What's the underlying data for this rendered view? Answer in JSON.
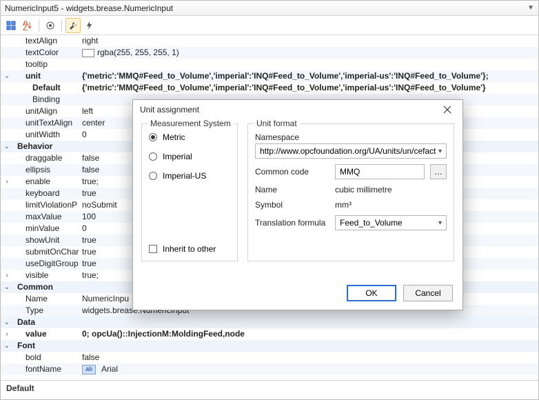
{
  "window": {
    "title": "NumericInput5 - widgets.brease.NumericInput"
  },
  "toolbar": {
    "btn1": "categorized-icon",
    "btn2": "sort-az-icon",
    "btn3": "target-icon",
    "btn4": "wrench-icon",
    "btn5": "bolt-icon"
  },
  "props": {
    "textAlign": {
      "k": "textAlign",
      "v": "right"
    },
    "textColor": {
      "k": "textColor",
      "v": "rgba(255, 255, 255, 1)"
    },
    "tooltip": {
      "k": "tooltip",
      "v": ""
    },
    "unit": {
      "k": "unit",
      "v": "{'metric':'MMQ#Feed_to_Volume','imperial':'INQ#Feed_to_Volume','imperial-us':'INQ#Feed_to_Volume'};"
    },
    "unitDefault": {
      "k": "Default",
      "v": "{'metric':'MMQ#Feed_to_Volume','imperial':'INQ#Feed_to_Volume','imperial-us':'INQ#Feed_to_Volume'}"
    },
    "unitBinding": {
      "k": "Binding",
      "v": ""
    },
    "unitAlign": {
      "k": "unitAlign",
      "v": "left"
    },
    "unitTextAlign": {
      "k": "unitTextAlign",
      "v": "center"
    },
    "unitWidth": {
      "k": "unitWidth",
      "v": "0"
    },
    "behavior": {
      "k": "Behavior"
    },
    "draggable": {
      "k": "draggable",
      "v": "false"
    },
    "ellipsis": {
      "k": "ellipsis",
      "v": "false"
    },
    "enable": {
      "k": "enable",
      "v": "true;"
    },
    "keyboard": {
      "k": "keyboard",
      "v": "true"
    },
    "limitViolationP": {
      "k": "limitViolationP",
      "v": "noSubmit"
    },
    "maxValue": {
      "k": "maxValue",
      "v": "100"
    },
    "minValue": {
      "k": "minValue",
      "v": "0"
    },
    "showUnit": {
      "k": "showUnit",
      "v": "true"
    },
    "submitOnChar": {
      "k": "submitOnChar",
      "v": "true"
    },
    "useDigitGroup": {
      "k": "useDigitGroup",
      "v": "true"
    },
    "visible": {
      "k": "visible",
      "v": "true;"
    },
    "common": {
      "k": "Common"
    },
    "name": {
      "k": "Name",
      "v": "NumericInpu"
    },
    "type": {
      "k": "Type",
      "v": "widgets.brease.NumericInput"
    },
    "data": {
      "k": "Data"
    },
    "value": {
      "k": "value",
      "v": "0; opcUa()::InjectionM:MoldingFeed,node"
    },
    "font": {
      "k": "Font"
    },
    "bold": {
      "k": "bold",
      "v": "false"
    },
    "fontName": {
      "k": "fontName",
      "v": "Arial"
    }
  },
  "footer": {
    "label": "Default"
  },
  "dialog": {
    "title": "Unit assignment",
    "left": {
      "legend": "Measurement System",
      "metric": "Metric",
      "imperial": "Imperial",
      "imperialus": "Imperial-US",
      "inherit": "Inherit to other"
    },
    "right": {
      "legend": "Unit format",
      "namespace_lbl": "Namespace",
      "namespace_val": "http://www.opcfoundation.org/UA/units/un/cefact",
      "common_lbl": "Common code",
      "common_val": "MMQ",
      "name_lbl": "Name",
      "name_val": "cubic millimetre",
      "symbol_lbl": "Symbol",
      "symbol_val": "mm³",
      "formula_lbl": "Translation formula",
      "formula_val": "Feed_to_Volume"
    },
    "ok": "OK",
    "cancel": "Cancel"
  }
}
